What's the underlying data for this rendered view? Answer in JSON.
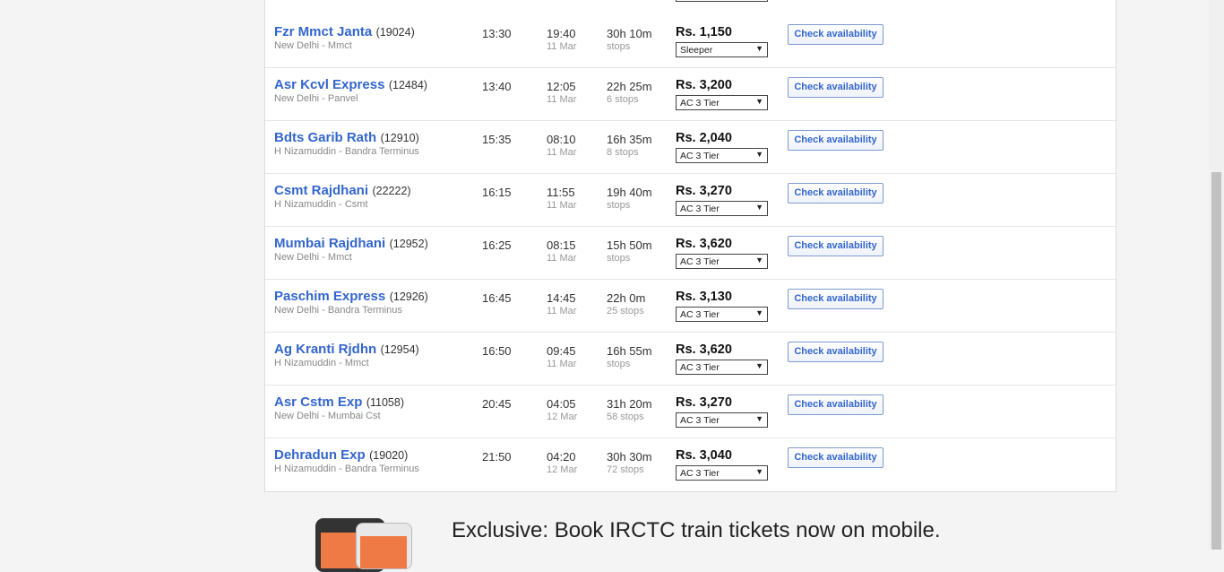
{
  "trains": [
    {
      "name": "Fzr Mmct Janta",
      "number": "(19024)",
      "route": "New Delhi - Mmct",
      "dep": "13:30",
      "arr": "19:40",
      "arr_date": "11 Mar",
      "duration": "30h 10m",
      "stops": "stops",
      "price": "Rs. 1,150",
      "class": "Sleeper",
      "button": "Check availability"
    },
    {
      "name": "Asr Kcvl Express",
      "number": "(12484)",
      "route": "New Delhi - Panvel",
      "dep": "13:40",
      "arr": "12:05",
      "arr_date": "11 Mar",
      "duration": "22h 25m",
      "stops": "6 stops",
      "price": "Rs. 3,200",
      "class": "AC 3 Tier",
      "button": "Check availability"
    },
    {
      "name": "Bdts Garib Rath",
      "number": "(12910)",
      "route": "H Nizamuddin - Bandra Terminus",
      "dep": "15:35",
      "arr": "08:10",
      "arr_date": "11 Mar",
      "duration": "16h 35m",
      "stops": "8 stops",
      "price": "Rs. 2,040",
      "class": "AC 3 Tier",
      "button": "Check availability"
    },
    {
      "name": "Csmt Rajdhani",
      "number": "(22222)",
      "route": "H Nizamuddin - Csmt",
      "dep": "16:15",
      "arr": "11:55",
      "arr_date": "11 Mar",
      "duration": "19h 40m",
      "stops": "stops",
      "price": "Rs. 3,270",
      "class": "AC 3 Tier",
      "button": "Check availability"
    },
    {
      "name": "Mumbai Rajdhani",
      "number": "(12952)",
      "route": "New Delhi - Mmct",
      "dep": "16:25",
      "arr": "08:15",
      "arr_date": "11 Mar",
      "duration": "15h 50m",
      "stops": "stops",
      "price": "Rs. 3,620",
      "class": "AC 3 Tier",
      "button": "Check availability"
    },
    {
      "name": "Paschim Express",
      "number": "(12926)",
      "route": "New Delhi - Bandra Terminus",
      "dep": "16:45",
      "arr": "14:45",
      "arr_date": "11 Mar",
      "duration": "22h 0m",
      "stops": "25 stops",
      "price": "Rs. 3,130",
      "class": "AC 3 Tier",
      "button": "Check availability"
    },
    {
      "name": "Ag Kranti Rjdhn",
      "number": "(12954)",
      "route": "H Nizamuddin - Mmct",
      "dep": "16:50",
      "arr": "09:45",
      "arr_date": "11 Mar",
      "duration": "16h 55m",
      "stops": "stops",
      "price": "Rs. 3,620",
      "class": "AC 3 Tier",
      "button": "Check availability"
    },
    {
      "name": "Asr Cstm Exp",
      "number": "(11058)",
      "route": "New Delhi - Mumbai Cst",
      "dep": "20:45",
      "arr": "04:05",
      "arr_date": "12 Mar",
      "duration": "31h 20m",
      "stops": "58 stops",
      "price": "Rs. 3,270",
      "class": "AC 3 Tier",
      "button": "Check availability"
    },
    {
      "name": "Dehradun Exp",
      "number": "(19020)",
      "route": "H Nizamuddin - Bandra Terminus",
      "dep": "21:50",
      "arr": "04:20",
      "arr_date": "12 Mar",
      "duration": "30h 30m",
      "stops": "72 stops",
      "price": "Rs. 3,040",
      "class": "AC 3 Tier",
      "button": "Check availability"
    }
  ],
  "dropdown_arrow": "▼",
  "promo": {
    "title": "Exclusive: Book IRCTC train tickets now on mobile."
  }
}
